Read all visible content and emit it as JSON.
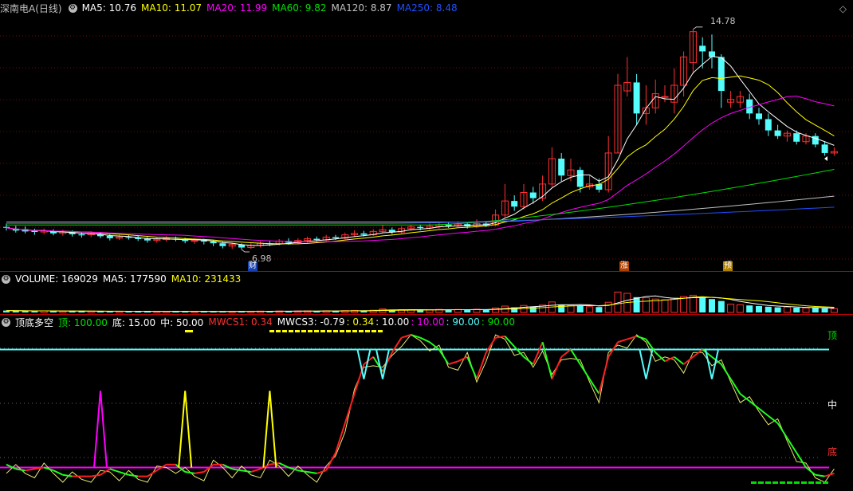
{
  "main_legend": {
    "stock": "深南电A(日线)",
    "ma5": "MA5: 10.76",
    "ma10": "MA10: 11.07",
    "ma20": "MA20: 11.99",
    "ma60": "MA60: 9.82",
    "ma120": "MA120: 8.87",
    "ma250": "MA250: 8.48"
  },
  "vol_legend": {
    "volume": "VOLUME: 169029",
    "ma5": "MA5: 177590",
    "ma10": "MA10: 231433"
  },
  "ind_legend": {
    "name": "顶底多空",
    "top": "顶: 100.00",
    "bottom": "底: 15.00",
    "mid": "中: 50.00",
    "mwcs1": "MWCS1: 0.34",
    "mwcs3": "MWCS3: -0.79",
    "v1": ": 0.34",
    "v2": ": 10.00",
    "v3": ": 10.00",
    "v4": ": 90.00",
    "v5": ": 90.00"
  },
  "markers": {
    "high": "14.78",
    "low": "6.98",
    "cai": "财",
    "zhang": "涨",
    "yu": "预"
  },
  "side_labels": {
    "top": "顶",
    "mid": "中",
    "bottom": "底"
  },
  "colors": {
    "up": "#ff3030",
    "down": "#54fcfc",
    "ma5": "#ffffff",
    "ma10": "#ffff00",
    "ma20": "#ff00ff",
    "ma60": "#00e000",
    "ma120": "#c0c0c0",
    "ma250": "#2050ff",
    "bg": "#000000"
  },
  "chart_data": [
    {
      "type": "candlestick",
      "title": "深南电A(日线)",
      "ohlc_note": "daily candles, price axis",
      "ylim": [
        6.5,
        15.2
      ],
      "high_label": 14.78,
      "low_label": 6.98,
      "ohlc": [
        [
          7.78,
          7.75,
          7.9,
          7.65
        ],
        [
          7.72,
          7.65,
          7.82,
          7.58
        ],
        [
          7.7,
          7.62,
          7.8,
          7.55
        ],
        [
          7.66,
          7.6,
          7.72,
          7.5
        ],
        [
          7.6,
          7.64,
          7.72,
          7.52
        ],
        [
          7.63,
          7.55,
          7.7,
          7.48
        ],
        [
          7.55,
          7.6,
          7.68,
          7.47
        ],
        [
          7.6,
          7.52,
          7.66,
          7.44
        ],
        [
          7.52,
          7.48,
          7.6,
          7.4
        ],
        [
          7.5,
          7.55,
          7.62,
          7.42
        ],
        [
          7.52,
          7.45,
          7.6,
          7.38
        ],
        [
          7.46,
          7.38,
          7.52,
          7.3
        ],
        [
          7.38,
          7.42,
          7.5,
          7.32
        ],
        [
          7.42,
          7.4,
          7.5,
          7.33
        ],
        [
          7.4,
          7.35,
          7.46,
          7.28
        ],
        [
          7.36,
          7.3,
          7.42,
          7.22
        ],
        [
          7.3,
          7.34,
          7.4,
          7.22
        ],
        [
          7.33,
          7.38,
          7.45,
          7.26
        ],
        [
          7.36,
          7.34,
          7.44,
          7.27
        ],
        [
          7.34,
          7.28,
          7.4,
          7.2
        ],
        [
          7.28,
          7.3,
          7.38,
          7.18
        ],
        [
          7.3,
          7.26,
          7.36,
          7.16
        ],
        [
          7.26,
          7.2,
          7.32,
          7.1
        ],
        [
          7.2,
          7.1,
          7.26,
          7.02
        ],
        [
          7.1,
          7.16,
          7.22,
          7.0
        ],
        [
          7.15,
          7.05,
          7.2,
          6.98
        ],
        [
          7.05,
          7.12,
          7.2,
          7.0
        ],
        [
          7.12,
          7.2,
          7.28,
          7.05
        ],
        [
          7.2,
          7.18,
          7.3,
          7.1
        ],
        [
          7.18,
          7.28,
          7.35,
          7.12
        ],
        [
          7.28,
          7.22,
          7.38,
          7.15
        ],
        [
          7.22,
          7.3,
          7.38,
          7.16
        ],
        [
          7.3,
          7.36,
          7.44,
          7.22
        ],
        [
          7.36,
          7.32,
          7.44,
          7.25
        ],
        [
          7.32,
          7.42,
          7.5,
          7.28
        ],
        [
          7.42,
          7.38,
          7.5,
          7.32
        ],
        [
          7.38,
          7.5,
          7.58,
          7.34
        ],
        [
          7.5,
          7.55,
          7.66,
          7.42
        ],
        [
          7.55,
          7.5,
          7.64,
          7.44
        ],
        [
          7.5,
          7.62,
          7.7,
          7.46
        ],
        [
          7.62,
          7.68,
          7.86,
          7.55
        ],
        [
          7.68,
          7.6,
          7.76,
          7.52
        ],
        [
          7.6,
          7.72,
          7.8,
          7.55
        ],
        [
          7.72,
          7.78,
          7.86,
          7.65
        ],
        [
          7.78,
          7.74,
          7.86,
          7.66
        ],
        [
          7.74,
          7.8,
          7.9,
          7.68
        ],
        [
          7.8,
          7.86,
          7.96,
          7.72
        ],
        [
          7.86,
          7.82,
          7.94,
          7.74
        ],
        [
          7.82,
          7.88,
          7.98,
          7.76
        ],
        [
          7.88,
          7.8,
          7.94,
          7.72
        ],
        [
          7.8,
          7.9,
          8.05,
          7.74
        ],
        [
          7.9,
          7.85,
          7.98,
          7.78
        ],
        [
          7.85,
          8.2,
          8.4,
          7.8
        ],
        [
          8.2,
          8.7,
          9.3,
          8.1
        ],
        [
          8.7,
          8.5,
          8.9,
          8.35
        ],
        [
          8.5,
          9.0,
          9.3,
          8.4
        ],
        [
          9.0,
          8.8,
          9.2,
          8.6
        ],
        [
          8.8,
          9.3,
          9.6,
          8.7
        ],
        [
          9.3,
          10.2,
          10.6,
          9.2
        ],
        [
          10.2,
          9.6,
          10.4,
          9.4
        ],
        [
          9.6,
          9.8,
          10.2,
          9.4
        ],
        [
          9.8,
          9.2,
          9.9,
          9.0
        ],
        [
          9.2,
          9.3,
          9.6,
          9.1
        ],
        [
          9.3,
          9.1,
          9.5,
          9.0
        ],
        [
          9.1,
          10.4,
          11.0,
          9.0
        ],
        [
          10.4,
          12.8,
          13.2,
          10.4
        ],
        [
          12.6,
          12.9,
          13.8,
          12.4
        ],
        [
          12.9,
          11.8,
          13.2,
          11.4
        ],
        [
          11.8,
          12.0,
          12.8,
          11.4
        ],
        [
          12.0,
          12.5,
          13.0,
          11.8
        ],
        [
          12.4,
          12.4,
          12.8,
          12.2
        ],
        [
          12.2,
          12.8,
          13.4,
          11.8
        ],
        [
          12.8,
          13.8,
          14.0,
          12.4
        ],
        [
          13.6,
          14.7,
          14.78,
          13.2
        ],
        [
          14.2,
          14.0,
          14.5,
          13.4
        ],
        [
          14.0,
          13.8,
          14.6,
          13.4
        ],
        [
          13.8,
          12.6,
          13.9,
          12.0
        ],
        [
          12.2,
          12.3,
          12.6,
          12.0
        ],
        [
          12.2,
          12.4,
          12.6,
          12.0
        ],
        [
          12.3,
          11.8,
          12.5,
          11.6
        ],
        [
          11.8,
          11.6,
          12.0,
          11.4
        ],
        [
          11.6,
          11.2,
          11.8,
          11.0
        ],
        [
          11.2,
          11.0,
          11.4,
          10.9
        ],
        [
          11.0,
          11.1,
          11.2,
          10.8
        ],
        [
          11.1,
          10.8,
          11.2,
          10.7
        ],
        [
          10.8,
          11.0,
          11.1,
          10.7
        ],
        [
          11.0,
          10.7,
          11.1,
          10.6
        ],
        [
          10.7,
          10.4,
          10.8,
          10.3
        ],
        [
          10.4,
          10.45,
          10.6,
          10.3
        ]
      ],
      "ma_lines": [
        {
          "name": "MA5",
          "color": "ma5"
        },
        {
          "name": "MA10",
          "color": "ma10"
        },
        {
          "name": "MA20",
          "color": "ma20"
        },
        {
          "name": "MA60",
          "color": "ma60",
          "values_end": 9.82
        },
        {
          "name": "MA120",
          "color": "ma120",
          "values_end": 8.87
        },
        {
          "name": "MA250",
          "color": "ma250",
          "values_end": 8.48
        }
      ]
    },
    {
      "type": "bar",
      "title": "VOLUME",
      "ylim": [
        0,
        800000
      ],
      "values": [
        60000,
        52000,
        48000,
        45000,
        50000,
        42000,
        40000,
        38000,
        36000,
        40000,
        38000,
        35000,
        33000,
        36000,
        34000,
        32000,
        35000,
        37000,
        34000,
        33000,
        31000,
        30000,
        29000,
        33000,
        36000,
        34000,
        38000,
        42000,
        40000,
        44000,
        42000,
        45000,
        48000,
        47000,
        52000,
        50000,
        58000,
        64000,
        60000,
        70000,
        110000,
        90000,
        85000,
        80000,
        78000,
        82000,
        95000,
        88000,
        92000,
        84000,
        100000,
        90000,
        140000,
        200000,
        160000,
        220000,
        180000,
        230000,
        330000,
        250000,
        220000,
        200000,
        180000,
        170000,
        320000,
        640000,
        600000,
        480000,
        460000,
        420000,
        400000,
        450000,
        500000,
        540000,
        460000,
        420000,
        360000,
        260000,
        240000,
        220000,
        200000,
        180000,
        160000,
        170000,
        150000,
        140000,
        150000,
        130000,
        120000
      ]
    },
    {
      "type": "line",
      "title": "顶底多空",
      "ylim": [
        0,
        100
      ],
      "levels": {
        "top": 90,
        "bottom": 10,
        "mid": 50
      },
      "values": [
        12,
        9,
        8,
        9,
        10,
        8,
        5,
        4,
        4,
        4,
        5,
        9,
        7,
        5,
        4,
        4,
        8,
        12,
        12,
        7,
        6,
        7,
        12,
        12,
        9,
        8,
        7,
        9,
        12,
        13,
        10,
        8,
        7,
        6,
        8,
        20,
        40,
        60,
        80,
        85,
        75,
        88,
        98,
        100,
        98,
        95,
        90,
        80,
        82,
        85,
        70,
        88,
        98,
        99,
        92,
        85,
        80,
        95,
        70,
        85,
        90,
        80,
        70,
        60,
        85,
        95,
        97,
        99,
        97,
        88,
        82,
        85,
        80,
        85,
        90,
        85,
        80,
        70,
        60,
        55,
        50,
        45,
        40,
        30,
        20,
        10,
        5,
        4,
        6
      ]
    }
  ]
}
